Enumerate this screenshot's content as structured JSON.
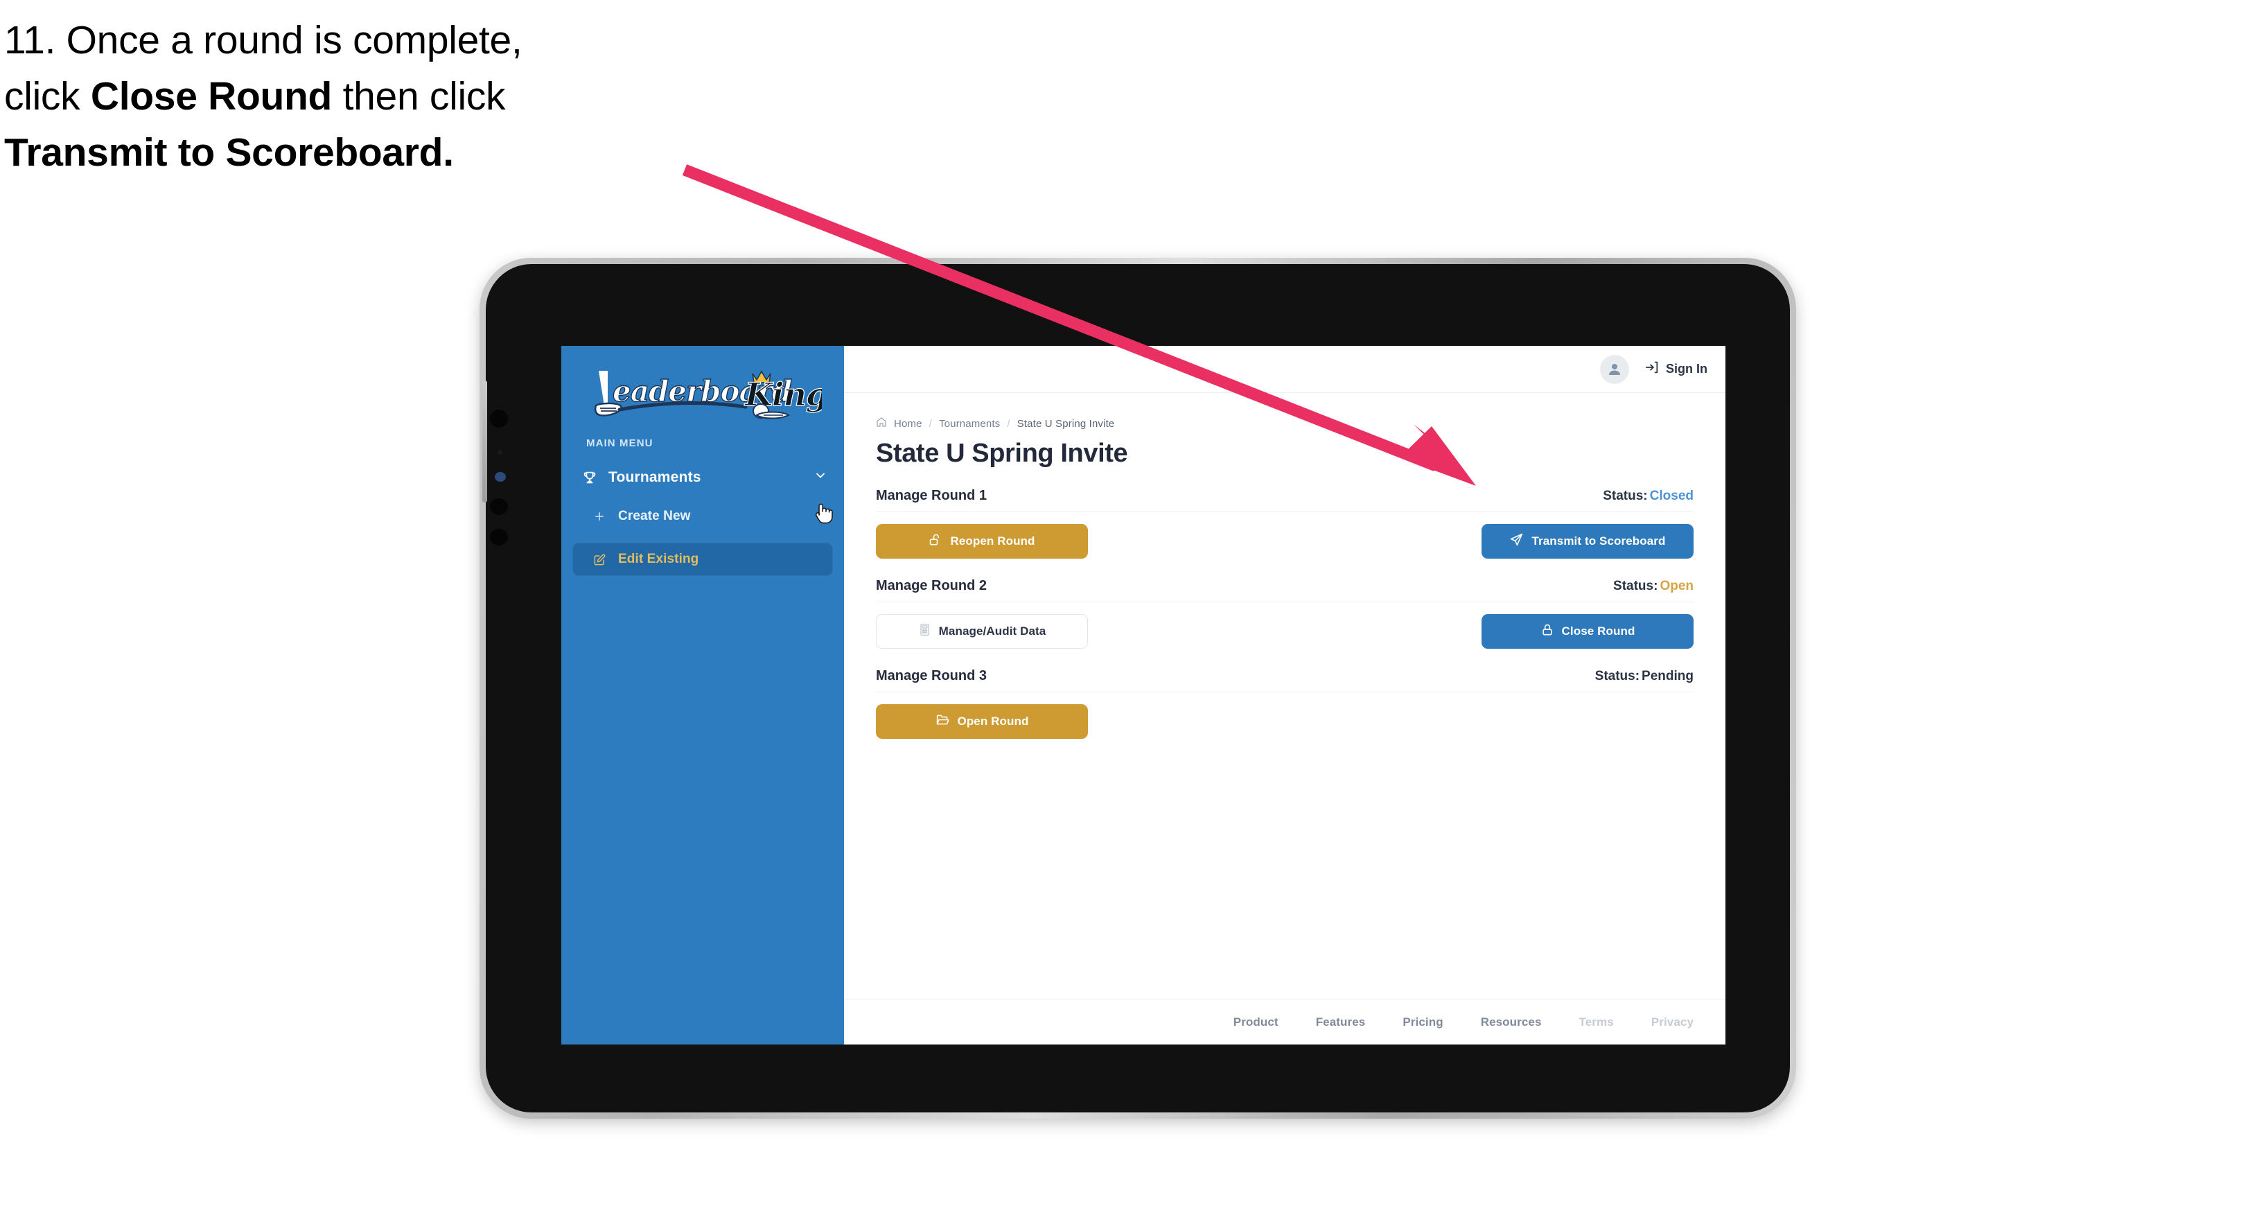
{
  "caption": {
    "line1_plain": "11. Once a round is complete,",
    "line2_pre": "click ",
    "line2_bold": "Close Round",
    "line2_post": " then click",
    "line3_bold": "Transmit to Scoreboard."
  },
  "annotation": {
    "arrow_color": "#ea2f63",
    "arrow_name": "pointer-arrow-to-transmit-button"
  },
  "device": {
    "frame_color": "#111111",
    "bezel_color": "#c9c9c9"
  },
  "sidebar": {
    "background": "#2e7cc0",
    "logo_word_1": "Leaderboard",
    "logo_word_2": "King",
    "section_label": "MAIN MENU",
    "nav": [
      {
        "label": "Tournaments",
        "icon": "trophy-icon",
        "chevron": "chevron-down-icon",
        "expanded": true
      }
    ],
    "sub_items": [
      {
        "label": "Create New",
        "icon": "plus-icon",
        "active": false
      },
      {
        "label": "Edit Existing",
        "icon": "edit-square-icon",
        "active": true
      }
    ],
    "active_item_text_color": "#e2bd5e",
    "active_item_bg": "#2368a6"
  },
  "topbar": {
    "avatar_icon": "user-avatar-icon",
    "signin_icon": "sign-in-arrow-icon",
    "signin_label": "Sign In"
  },
  "breadcrumb": {
    "home_icon": "home-icon",
    "items": [
      "Home",
      "Tournaments",
      "State U Spring Invite"
    ],
    "separator": "/"
  },
  "page": {
    "title": "State U Spring Invite"
  },
  "rounds": [
    {
      "title": "Manage Round 1",
      "status_label": "Status:",
      "status_value": "Closed",
      "status_kind": "closed",
      "left_button": {
        "label": "Reopen Round",
        "icon": "unlock-icon",
        "style": "gold"
      },
      "right_button": {
        "label": "Transmit to Scoreboard",
        "icon": "send-plane-icon",
        "style": "blue"
      }
    },
    {
      "title": "Manage Round 2",
      "status_label": "Status:",
      "status_value": "Open",
      "status_kind": "open",
      "left_button": {
        "label": "Manage/Audit Data",
        "icon": "calculator-icon",
        "style": "ghost"
      },
      "right_button": {
        "label": "Close Round",
        "icon": "lock-icon",
        "style": "blue"
      }
    },
    {
      "title": "Manage Round 3",
      "status_label": "Status:",
      "status_value": "Pending",
      "status_kind": "pending",
      "left_button": {
        "label": "Open Round",
        "icon": "folder-open-icon",
        "style": "gold"
      },
      "right_button": null
    }
  ],
  "footer": {
    "links": [
      {
        "label": "Product",
        "muted": false
      },
      {
        "label": "Features",
        "muted": false
      },
      {
        "label": "Pricing",
        "muted": false
      },
      {
        "label": "Resources",
        "muted": false
      },
      {
        "label": "Terms",
        "muted": true
      },
      {
        "label": "Privacy",
        "muted": true
      }
    ]
  },
  "cursor": {
    "type": "pointing-hand-cursor"
  },
  "colors": {
    "gold": "#ce9b33",
    "blue": "#2d79bc",
    "status_closed": "#4f93d7",
    "status_open": "#d8a441",
    "sidebar_blue": "#2e7cc0"
  }
}
